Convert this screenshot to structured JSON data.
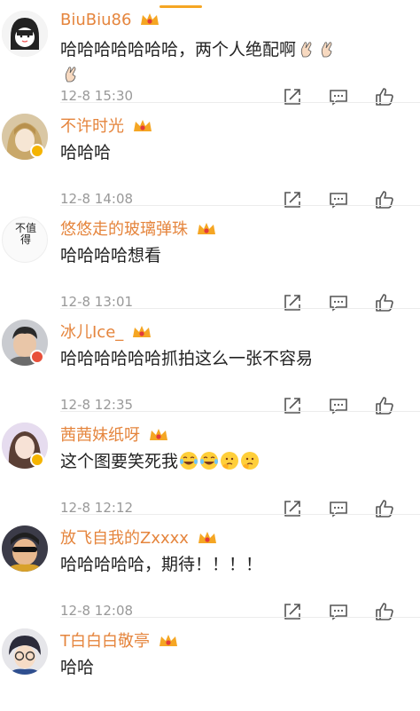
{
  "comments": [
    {
      "user": "BiuBiu86",
      "text": "哈哈哈哈哈哈哈，两个人绝配啊",
      "time": "12-8 15:30",
      "emoji": "hand-gesture-icon",
      "avatar_label": ""
    },
    {
      "user": "不许时光",
      "text": "哈哈哈",
      "time": "12-8 14:08",
      "emoji": "",
      "avatar_label": ""
    },
    {
      "user": "悠悠走的玻璃弹珠",
      "text": "哈哈哈哈想看",
      "time": "12-8 13:01",
      "emoji": "",
      "avatar_label": "不值得"
    },
    {
      "user": "冰儿Ice_",
      "text": "哈哈哈哈哈哈抓拍这么一张不容易",
      "time": "12-8 12:35",
      "emoji": "",
      "avatar_label": ""
    },
    {
      "user": "茜茜妹纸呀",
      "text": "这个图要笑死我",
      "time": "12-8 12:12",
      "emoji": "laughing-crying-emoji",
      "avatar_label": ""
    },
    {
      "user": "放飞自我的Zxxxx",
      "text": "哈哈哈哈哈，期待！！！！",
      "time": "12-8 12:08",
      "emoji": "",
      "avatar_label": ""
    },
    {
      "user": "T白白白敬亭",
      "text": "哈哈",
      "time": "",
      "emoji": "",
      "avatar_label": ""
    }
  ],
  "colors": {
    "username": "#e5853d",
    "text": "#222222",
    "time": "#999999",
    "accent": "#f5a623"
  }
}
